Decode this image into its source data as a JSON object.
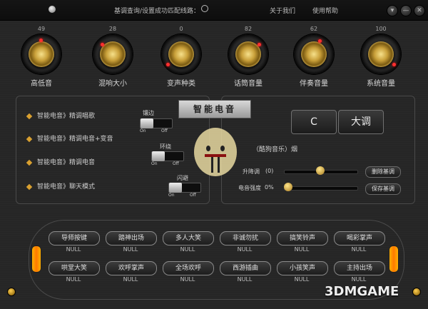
{
  "topbar": {
    "status_text": "基调查询/设置成功",
    "status_right": "匹配线路：",
    "about": "关于我们",
    "help": "使用帮助",
    "window_buttons": [
      "▾",
      "—",
      "✕"
    ]
  },
  "knobs": [
    {
      "value": "49",
      "label": "高低音"
    },
    {
      "value": "28",
      "label": "混响大小"
    },
    {
      "value": "0",
      "label": "变声种类"
    },
    {
      "value": "82",
      "label": "话筒音量"
    },
    {
      "value": "62",
      "label": "伴奏音量"
    },
    {
      "value": "100",
      "label": "系统音量"
    }
  ],
  "modes": [
    {
      "label": "智能电音》精调唱歌"
    },
    {
      "label": "智能电音》精调电音+变音"
    },
    {
      "label": "智能电音》精调电音"
    },
    {
      "label": "智能电音》聊天模式"
    }
  ],
  "toggles": [
    {
      "label": "镶边",
      "on": "On",
      "off": "Off"
    },
    {
      "label": "环绕",
      "on": "On",
      "off": "Off"
    },
    {
      "label": "闪避",
      "on": "On",
      "off": "Off"
    }
  ],
  "title_plate": "智能电音",
  "key": {
    "note": "C",
    "scale": "大调"
  },
  "song": "（酷狗音乐）烟",
  "pitch": {
    "label": "升降调",
    "value": "(0)",
    "level": 0.5
  },
  "intensity": {
    "label": "电音强度",
    "value": "0%",
    "level": 0.0
  },
  "buttons": {
    "delete": "删除基调",
    "save": "保存基调"
  },
  "soundboard": {
    "row1": [
      "导师按键",
      "踏神出场",
      "多人大笑",
      "非诚勿扰",
      "搞笑铃声",
      "喝彩掌声"
    ],
    "row2": [
      "哄堂大笑",
      "欢呼掌声",
      "全场欢呼",
      "西游插曲",
      "小孩笑声",
      "主持出场"
    ],
    "null_label": "NULL"
  },
  "watermark": "3DMGAME",
  "colors": {
    "accent_gold": "#d9a030",
    "slot_orange": "#ff9a00",
    "knob_dot": "#ff3030"
  }
}
